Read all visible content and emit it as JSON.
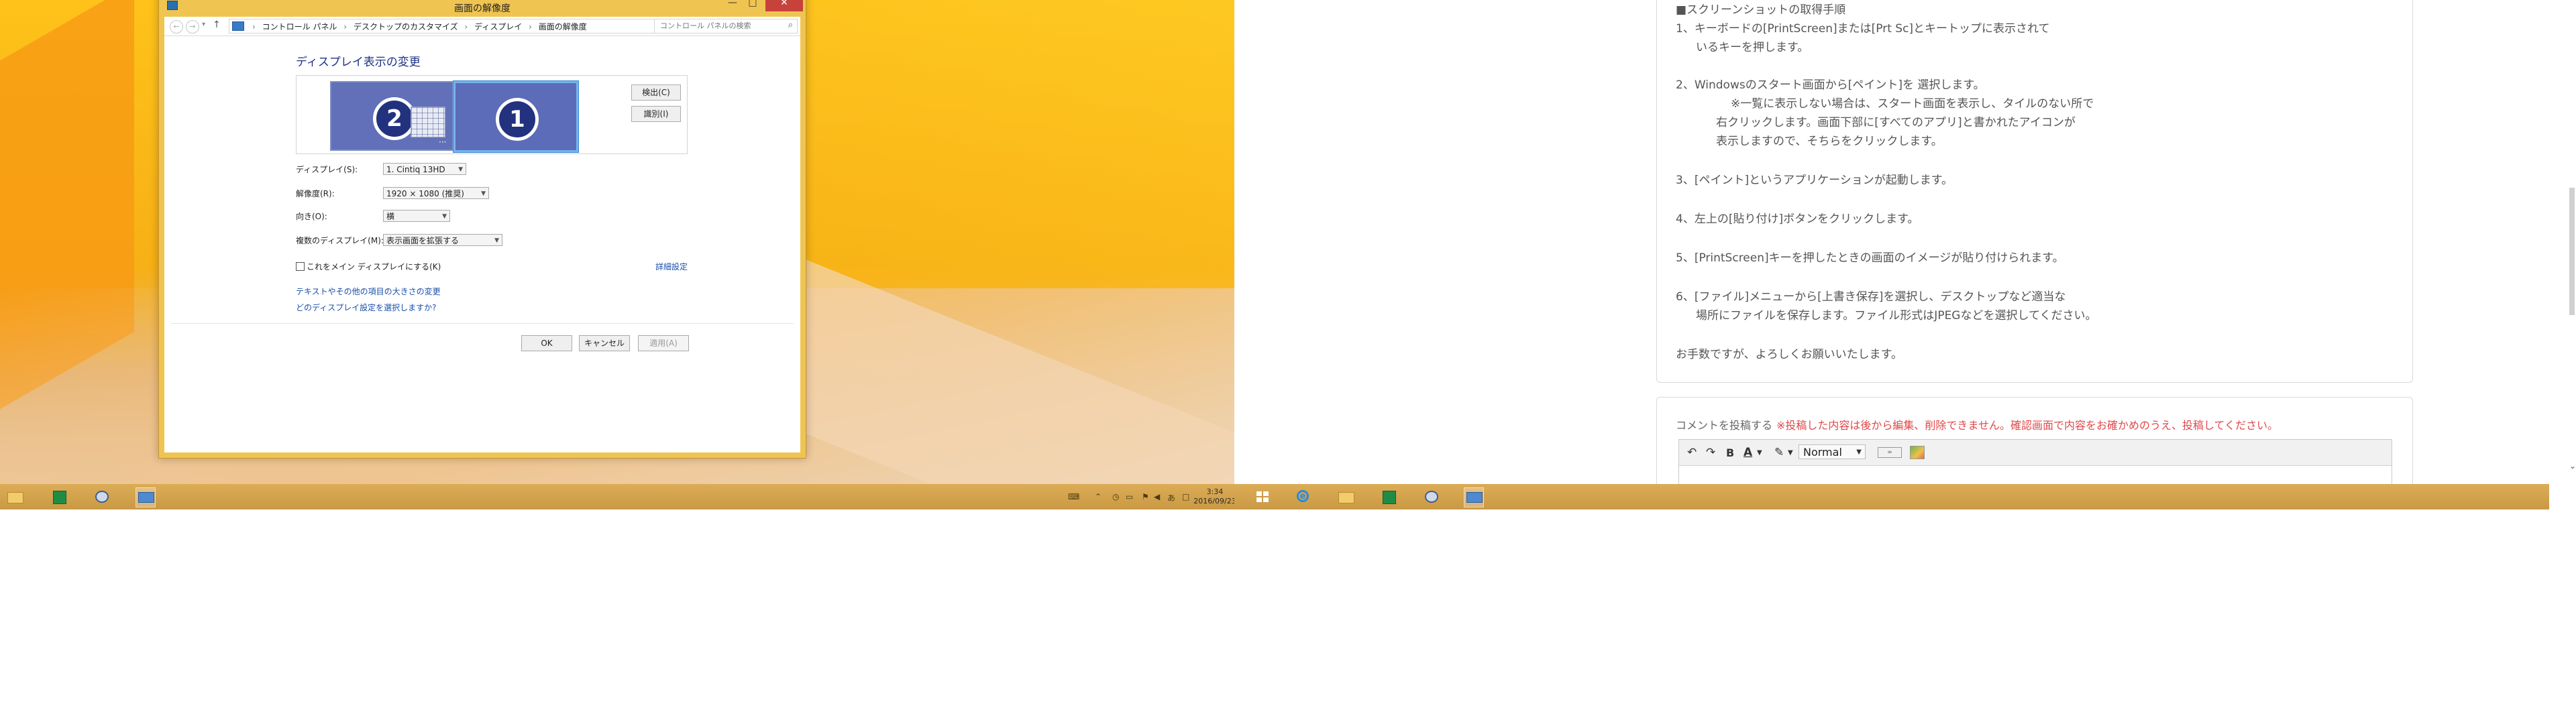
{
  "dialog": {
    "title": "画面の解像度",
    "window_buttons": {
      "minimize": "—",
      "maximize": "□",
      "close": "✕"
    },
    "breadcrumb": [
      "コントロール パネル",
      "デスクトップのカスタマイズ",
      "ディスプレイ",
      "画面の解像度"
    ],
    "search_placeholder": "コントロール パネルの検索",
    "heading": "ディスプレイ表示の変更",
    "monitors": [
      {
        "number": "2"
      },
      {
        "number": "1"
      }
    ],
    "detect_label": "検出(C)",
    "identify_label": "識別(I)",
    "fields": {
      "display": {
        "label": "ディスプレイ(S):",
        "value": "1. Cintiq 13HD"
      },
      "resolution": {
        "label": "解像度(R):",
        "value": "1920 × 1080 (推奨)"
      },
      "orientation": {
        "label": "向き(O):",
        "value": "横"
      },
      "multiple": {
        "label": "複数のディスプレイ(M):",
        "value": "表示画面を拡張する"
      }
    },
    "main_display_checkbox": "これをメイン ディスプレイにする(K)",
    "advanced_link": "詳細設定",
    "link_text_size": "テキストやその他の項目の大きさの変更",
    "link_which_settings": "どのディスプレイ設定を選択しますか?",
    "ok_label": "OK",
    "cancel_label": "キャンセル",
    "apply_label": "適用(A)"
  },
  "article": {
    "lines": [
      "■スクリーンショットの取得手順",
      "1、キーボードの[PrintScreen]または[Prt Sc]とキートップに表示されて",
      "いるキーを押します。",
      "2、Windowsのスタート画面から[ペイント]を 選択します。",
      "※一覧に表示しない場合は、スタート画面を表示し、タイルのない所で",
      "右クリックします。画面下部に[すべてのアプリ]と書かれたアイコンが",
      "表示しますので、そちらをクリックします。",
      "3、[ペイント]というアプリケーションが起動します。",
      "4、左上の[貼り付け]ボタンをクリックします。",
      "5、[PrintScreen]キーを押したときの画面のイメージが貼り付けられます。",
      "6、[ファイル]メニューから[上書き保存]を選択し、デスクトップなど適当な",
      "場所にファイルを保存します。ファイル形式はJPEGなどを選択してください。",
      "お手数ですが、よろしくお願いいたします。"
    ]
  },
  "comment": {
    "title": "コメントを投稿する",
    "note": "※投稿した内容は後から編集、削除できません。確認画面で内容をお確かめのうえ、投稿してください。",
    "toolbar": {
      "undo": "↶",
      "redo": "↷",
      "bold": "B",
      "font_color": "A",
      "format_value": "Normal"
    }
  },
  "taskbar": {
    "clock_time": "3:34",
    "clock_date": "2016/09/23"
  },
  "colors": {
    "desktop_accent": "#fbb914",
    "taskbar": "#d0a04a",
    "link": "#1a4fa8",
    "heading": "#1e3287",
    "comment_note": "#e0484a"
  }
}
